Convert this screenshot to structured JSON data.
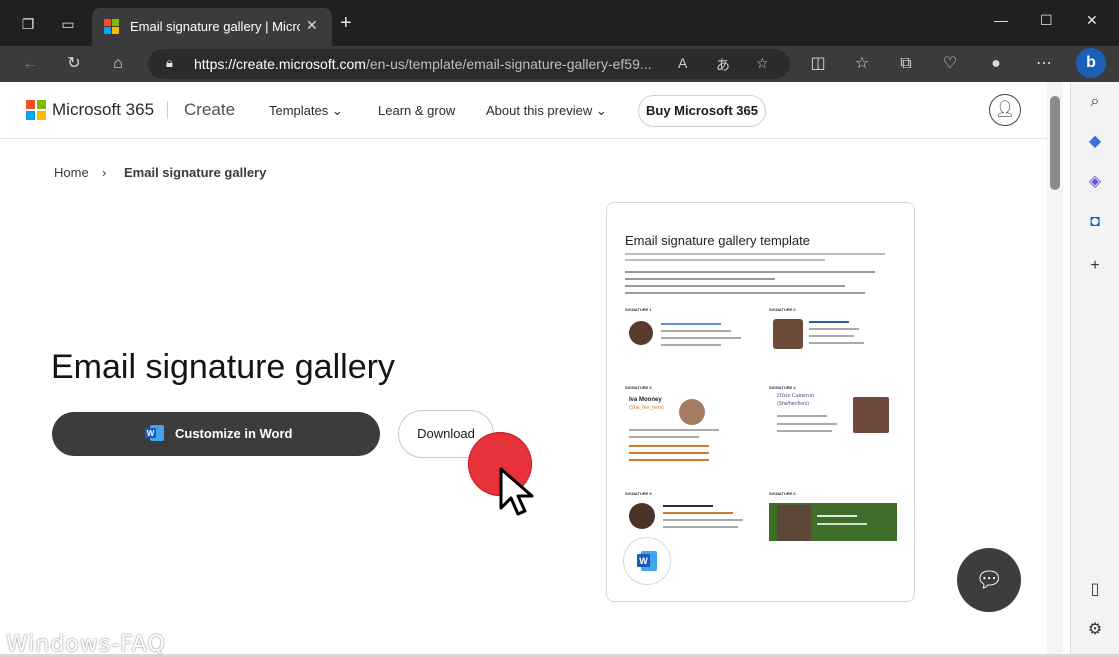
{
  "browser": {
    "tab_title": "Email signature gallery | Microsoft",
    "tab_close": "✕",
    "new_tab": "+",
    "url_host": "https://create.microsoft.com",
    "url_path": "/en-us/template/email-signature-gallery-ef59...",
    "window_controls": {
      "minimize": "—",
      "maximize": "☐",
      "close": "✕"
    }
  },
  "nav": {
    "brand": "Microsoft 365",
    "section": "Create",
    "links": [
      "Templates",
      "Learn & grow",
      "About this preview"
    ],
    "buy_label": "Buy Microsoft 365"
  },
  "breadcrumb": {
    "home": "Home",
    "separator": "›",
    "current": "Email signature gallery"
  },
  "hero": {
    "title": "Email signature gallery",
    "customize_label": "Customize in Word",
    "download_label": "Download"
  },
  "preview": {
    "title": "Email signature gallery template",
    "signature_labels": [
      "SIGNATURE 1",
      "SIGNATURE 2",
      "SIGNATURE 3",
      "SIGNATURE 4",
      "SIGNATURE 5",
      "SIGNATURE 6"
    ],
    "sig3_name": "Iva Mooney",
    "sig3_pronouns": "(She_her_hers)",
    "sig4_name": "Dixie Cameron",
    "sig4_pronouns": "(She/her/hers)"
  },
  "watermark": "Windows-FAQ",
  "colors": {
    "accent": "#e8323a",
    "button_dark": "#3c3c3c",
    "browser_dark": "#202020"
  }
}
